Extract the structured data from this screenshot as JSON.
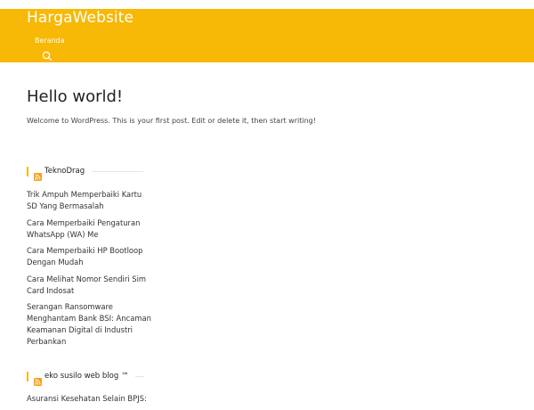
{
  "site": {
    "title": "HargaWebsite",
    "brand_color": "#f7b806"
  },
  "nav": {
    "home_label": "Beranda",
    "search_icon": "search-icon"
  },
  "post": {
    "title": "Hello world!",
    "content": "Welcome to WordPress. This is your first post. Edit or delete it, then start writing!"
  },
  "widgets": [
    {
      "title": "TeknoDrag",
      "icon": "rss-icon",
      "items": [
        "Trik Ampuh Memperbaiki Kartu SD Yang Bermasalah",
        "Cara Memperbaiki Pengaturan WhatsApp (WA) Me",
        "Cara Memperbaiki HP Bootloop Dengan Mudah",
        "Cara Melihat Nomor Sendiri Sim Card Indosat",
        "Serangan Ransomware Menghantam Bank BSI: Ancaman Keamanan Digital di Industri Perbankan"
      ]
    },
    {
      "title": "eko susilo web blog ™",
      "icon": "rss-icon",
      "items": [
        "Asuransi Kesehatan Selain BPJS:"
      ]
    }
  ]
}
